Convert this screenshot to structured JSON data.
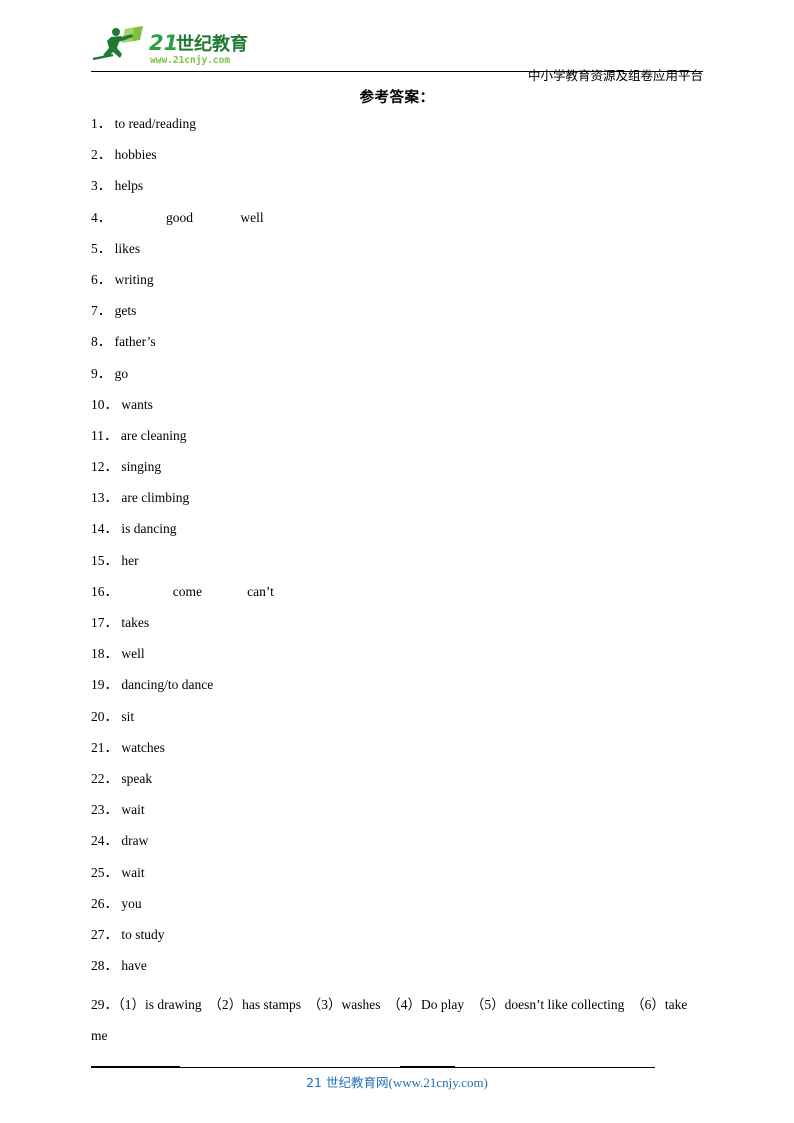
{
  "header": {
    "logo_text_main": "21世纪教育",
    "logo_text_url": "www.21cnjy.com",
    "tagline": "中小学教育资源及组卷应用平台",
    "logo_color_dark": "#1f7a34",
    "logo_color_light": "#7fbf3f"
  },
  "title": "参考答案：",
  "answers": [
    {
      "num": "1．",
      "text": "to read/reading"
    },
    {
      "num": "2．",
      "text": "hobbies"
    },
    {
      "num": "3．",
      "text": "helps"
    },
    {
      "num": "4．",
      "slot1": "good",
      "slot2": "well"
    },
    {
      "num": "5．",
      "text": "likes"
    },
    {
      "num": "6．",
      "text": "writing"
    },
    {
      "num": "7．",
      "text": "gets"
    },
    {
      "num": "8．",
      "text": "father’s"
    },
    {
      "num": "9．",
      "text": "go"
    },
    {
      "num": "10．",
      "text": "wants"
    },
    {
      "num": "11．",
      "text": "are cleaning"
    },
    {
      "num": "12．",
      "text": "singing"
    },
    {
      "num": "13．",
      "text": "are climbing"
    },
    {
      "num": "14．",
      "text": "is dancing"
    },
    {
      "num": "15．",
      "text": "her"
    },
    {
      "num": "16．",
      "slot1": "come",
      "slot2": "can’t"
    },
    {
      "num": "17．",
      "text": "takes"
    },
    {
      "num": "18．",
      "text": "well"
    },
    {
      "num": "19．",
      "text": "dancing/to dance"
    },
    {
      "num": "20．",
      "text": "sit"
    },
    {
      "num": "21．",
      "text": "watches"
    },
    {
      "num": "22．",
      "text": "speak"
    },
    {
      "num": "23．",
      "text": "wait"
    },
    {
      "num": "24．",
      "text": "draw"
    },
    {
      "num": "25．",
      "text": "wait"
    },
    {
      "num": "26．",
      "text": "you"
    },
    {
      "num": "27．",
      "text": "to study"
    },
    {
      "num": "28．",
      "text": "have"
    }
  ],
  "answer_29": {
    "num": "29．",
    "parts": [
      "（1）is drawing",
      "（2）has stamps",
      "（3）washes",
      "（4）Do play",
      "（5）doesn’t like collecting",
      "（6）take me"
    ]
  },
  "footer": {
    "cn_text": "21 世纪教育网",
    "url_text": "(www.21cnjy.com)",
    "color": "#1f6fb5"
  }
}
